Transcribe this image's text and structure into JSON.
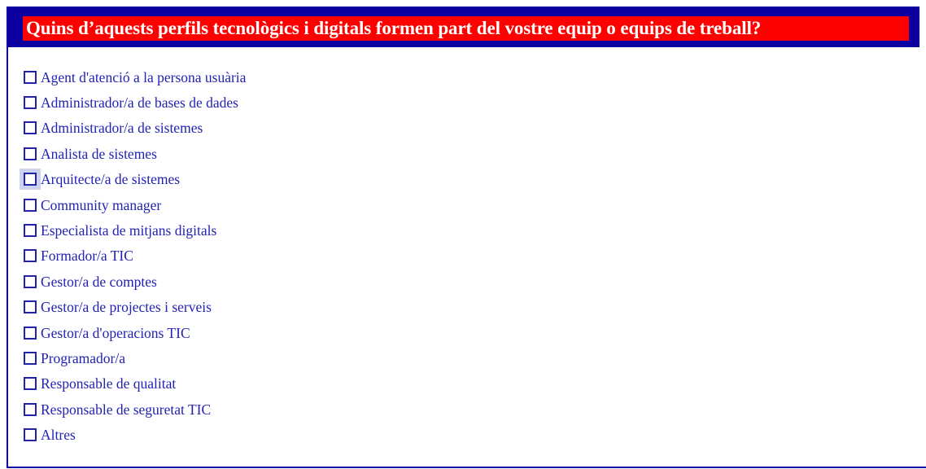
{
  "header": {
    "question": "Quins d’aquests perfils tecnològics i digitals formen part del vostre equip o equips de treball?",
    "band_color": "#0c00a0",
    "title_bar_color": "#fd0000",
    "title_text_color": "#ffffff"
  },
  "options_panel": {
    "border_color": "#0c00a0",
    "label_color": "#2222b4",
    "checkbox_border_color": "#2222aa",
    "focus_highlight_color": "#ccd3ee",
    "options": [
      {
        "label": "Agent d'atenció a la persona usuària",
        "checked": false,
        "focused": false
      },
      {
        "label": "Administrador/a de bases de dades",
        "checked": false,
        "focused": false
      },
      {
        "label": "Administrador/a de sistemes",
        "checked": false,
        "focused": false
      },
      {
        "label": "Analista de sistemes",
        "checked": false,
        "focused": false
      },
      {
        "label": "Arquitecte/a de sistemes",
        "checked": false,
        "focused": true
      },
      {
        "label": "Community manager",
        "checked": false,
        "focused": false
      },
      {
        "label": "Especialista de mitjans digitals",
        "checked": false,
        "focused": false
      },
      {
        "label": "Formador/a TIC",
        "checked": false,
        "focused": false
      },
      {
        "label": "Gestor/a de comptes",
        "checked": false,
        "focused": false
      },
      {
        "label": "Gestor/a de projectes i serveis",
        "checked": false,
        "focused": false
      },
      {
        "label": "Gestor/a d'operacions TIC",
        "checked": false,
        "focused": false
      },
      {
        "label": "Programador/a",
        "checked": false,
        "focused": false
      },
      {
        "label": "Responsable de qualitat",
        "checked": false,
        "focused": false
      },
      {
        "label": "Responsable de seguretat TIC",
        "checked": false,
        "focused": false
      },
      {
        "label": "Altres",
        "checked": false,
        "focused": false
      }
    ]
  }
}
